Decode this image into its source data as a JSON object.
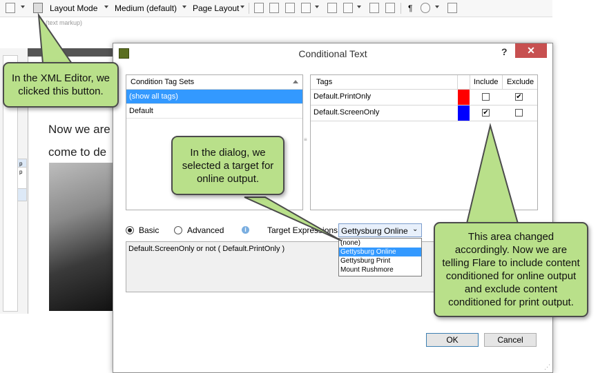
{
  "toolbar": {
    "layout_mode": "Layout Mode",
    "medium": "Medium (default)",
    "page_layout": "Page Layout",
    "text_markup": "(text markup)"
  },
  "editor": {
    "line1": "Now we are",
    "line2": "come to de",
    "strip_label": "p"
  },
  "dialog": {
    "title": "Conditional Text",
    "help": "?",
    "close": "✕",
    "condition_tag_sets": {
      "header": "Condition Tag Sets",
      "items": [
        "(show all tags)",
        "Default"
      ]
    },
    "tags": {
      "header_tags": "Tags",
      "header_include": "Include",
      "header_exclude": "Exclude",
      "rows": [
        {
          "name": "Default.PrintOnly",
          "color": "#ff0000",
          "include": false,
          "exclude": true
        },
        {
          "name": "Default.ScreenOnly",
          "color": "#0000ff",
          "include": true,
          "exclude": false
        }
      ]
    },
    "mode": {
      "basic": "Basic",
      "advanced": "Advanced"
    },
    "target_expressions_label": "Target Expressions:",
    "target_select_value": "Gettysburg Online",
    "target_options": [
      "(none)",
      "Gettysburg Online",
      "Gettysburg Print",
      "Mount Rushmore"
    ],
    "expression_text": "Default.ScreenOnly or not ( Default.PrintOnly )",
    "ok": "OK",
    "cancel": "Cancel"
  },
  "callouts": {
    "xml_editor": "In the XML Editor, we clicked this button.",
    "dialog": "In the dialog, we selected a target for online output.",
    "area": "This area changed accordingly. Now we are telling Flare to include content conditioned for online output and exclude content conditioned for print output."
  }
}
